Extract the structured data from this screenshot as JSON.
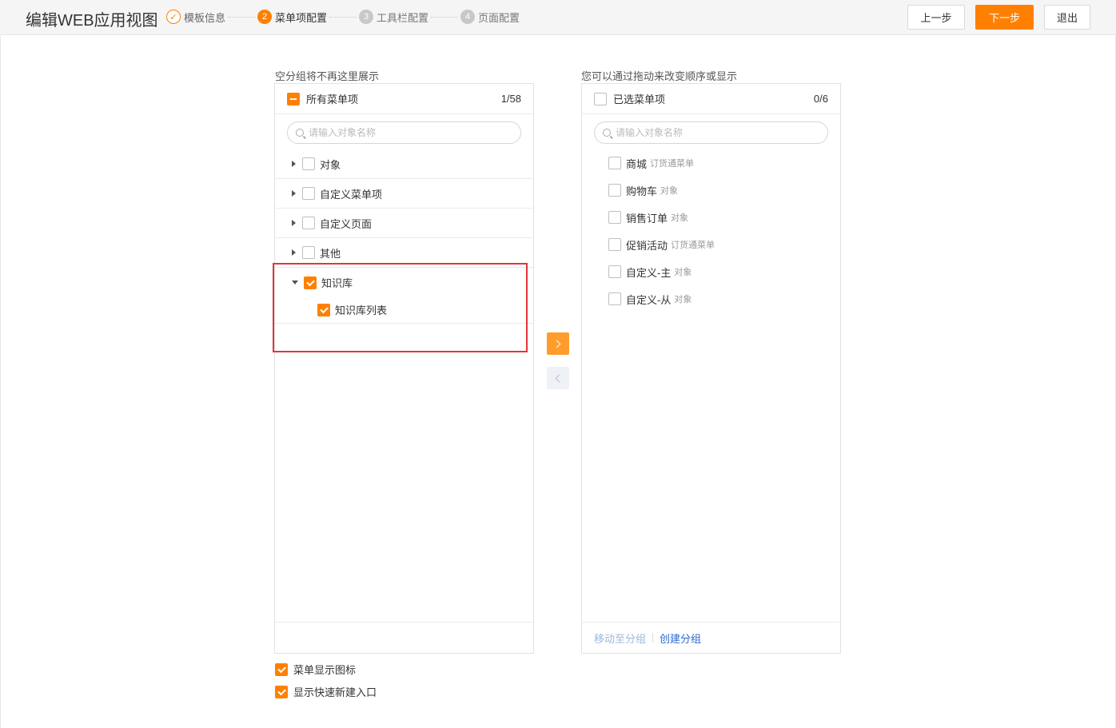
{
  "header": {
    "title": "编辑WEB应用视图",
    "steps": [
      {
        "num": "✓",
        "label": "模板信息"
      },
      {
        "num": "2",
        "label": "菜单项配置"
      },
      {
        "num": "3",
        "label": "工具栏配置"
      },
      {
        "num": "4",
        "label": "页面配置"
      }
    ],
    "prev_label": "上一步",
    "next_label": "下一步",
    "exit_label": "退出"
  },
  "left": {
    "hint": "空分组将不再这里展示",
    "title": "所有菜单项",
    "count": "1/58",
    "search_placeholder": "请输入对象名称",
    "groups": [
      {
        "label": "对象"
      },
      {
        "label": "自定义菜单项"
      },
      {
        "label": "自定义页面"
      },
      {
        "label": "其他"
      },
      {
        "label": "知识库"
      }
    ],
    "sub_item": "知识库列表"
  },
  "right": {
    "hint": "您可以通过拖动来改变顺序或显示",
    "title": "已选菜单项",
    "count": "0/6",
    "search_placeholder": "请输入对象名称",
    "items": [
      {
        "name": "商城",
        "type": "订货通菜单"
      },
      {
        "name": "购物车",
        "type": "对象"
      },
      {
        "name": "销售订单",
        "type": "对象"
      },
      {
        "name": "促销活动",
        "type": "订货通菜单"
      },
      {
        "name": "自定义-主",
        "type": "对象"
      },
      {
        "name": "自定义-从",
        "type": "对象"
      }
    ],
    "move_to_group": "移动至分组",
    "create_group": "创建分组"
  },
  "options": {
    "show_icon": "菜单显示图标",
    "show_quick_create": "显示快速新建入口"
  },
  "colors": {
    "accent": "#ff8000",
    "highlight_box": "#e0363b",
    "link": "#2a6bd1"
  }
}
